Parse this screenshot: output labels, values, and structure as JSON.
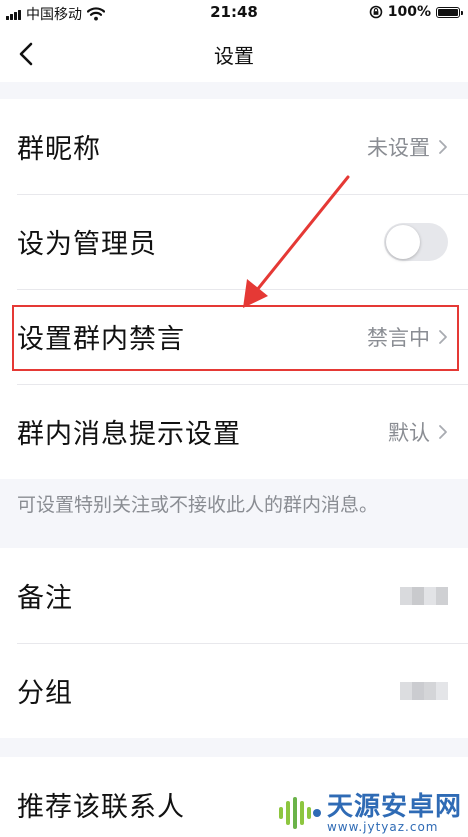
{
  "status_bar": {
    "carrier": "中国移动",
    "time": "21:48",
    "battery": "100%",
    "battery_level": 1.0
  },
  "nav": {
    "title": "设置"
  },
  "settings_group_1": {
    "nickname_label": "群昵称",
    "nickname_value": "未设置",
    "admin_label": "设为管理员",
    "admin_toggle_on": false,
    "mute_label": "设置群内禁言",
    "mute_value": "禁言中",
    "notify_label": "群内消息提示设置",
    "notify_value": "默认"
  },
  "hint_text": "可设置特别关注或不接收此人的群内消息。",
  "settings_group_2": {
    "remark_label": "备注",
    "group_label": "分组"
  },
  "settings_group_3": {
    "recommend_label": "推荐该联系人"
  },
  "watermark": {
    "title": "天源安卓网",
    "url": "www.jytyaz.com"
  },
  "colors": {
    "highlight_border": "#e53935",
    "secondary_text": "#8a8d93",
    "background": "#f5f6fa"
  },
  "icons": {
    "back": "chevron-left-icon",
    "chevron": "chevron-right-icon",
    "wifi": "wifi-icon",
    "lock": "rotation-lock-icon",
    "battery": "battery-icon"
  }
}
